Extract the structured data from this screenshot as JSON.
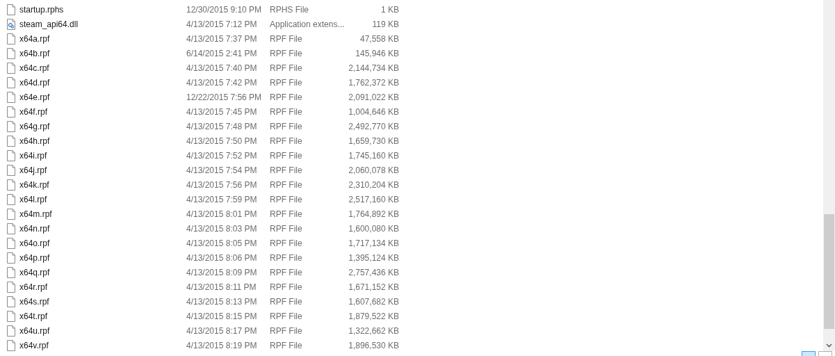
{
  "files": [
    {
      "name": "startup.rphs",
      "date": "12/30/2015 9:10 PM",
      "type": "RPHS File",
      "size": "1 KB",
      "kind": "document"
    },
    {
      "name": "steam_api64.dll",
      "date": "4/13/2015 7:12 PM",
      "type": "Application extens...",
      "size": "119 KB",
      "kind": "dll"
    },
    {
      "name": "x64a.rpf",
      "date": "4/13/2015 7:37 PM",
      "type": "RPF File",
      "size": "47,558 KB",
      "kind": "document"
    },
    {
      "name": "x64b.rpf",
      "date": "6/14/2015 2:41 PM",
      "type": "RPF File",
      "size": "145,946 KB",
      "kind": "document"
    },
    {
      "name": "x64c.rpf",
      "date": "4/13/2015 7:40 PM",
      "type": "RPF File",
      "size": "2,144,734 KB",
      "kind": "document"
    },
    {
      "name": "x64d.rpf",
      "date": "4/13/2015 7:42 PM",
      "type": "RPF File",
      "size": "1,762,372 KB",
      "kind": "document"
    },
    {
      "name": "x64e.rpf",
      "date": "12/22/2015 7:56 PM",
      "type": "RPF File",
      "size": "2,091,022 KB",
      "kind": "document"
    },
    {
      "name": "x64f.rpf",
      "date": "4/13/2015 7:45 PM",
      "type": "RPF File",
      "size": "1,004,646 KB",
      "kind": "document"
    },
    {
      "name": "x64g.rpf",
      "date": "4/13/2015 7:48 PM",
      "type": "RPF File",
      "size": "2,492,770 KB",
      "kind": "document"
    },
    {
      "name": "x64h.rpf",
      "date": "4/13/2015 7:50 PM",
      "type": "RPF File",
      "size": "1,659,730 KB",
      "kind": "document"
    },
    {
      "name": "x64i.rpf",
      "date": "4/13/2015 7:52 PM",
      "type": "RPF File",
      "size": "1,745,160 KB",
      "kind": "document"
    },
    {
      "name": "x64j.rpf",
      "date": "4/13/2015 7:54 PM",
      "type": "RPF File",
      "size": "2,060,078 KB",
      "kind": "document"
    },
    {
      "name": "x64k.rpf",
      "date": "4/13/2015 7:56 PM",
      "type": "RPF File",
      "size": "2,310,204 KB",
      "kind": "document"
    },
    {
      "name": "x64l.rpf",
      "date": "4/13/2015 7:59 PM",
      "type": "RPF File",
      "size": "2,517,160 KB",
      "kind": "document"
    },
    {
      "name": "x64m.rpf",
      "date": "4/13/2015 8:01 PM",
      "type": "RPF File",
      "size": "1,764,892 KB",
      "kind": "document"
    },
    {
      "name": "x64n.rpf",
      "date": "4/13/2015 8:03 PM",
      "type": "RPF File",
      "size": "1,600,080 KB",
      "kind": "document"
    },
    {
      "name": "x64o.rpf",
      "date": "4/13/2015 8:05 PM",
      "type": "RPF File",
      "size": "1,717,134 KB",
      "kind": "document"
    },
    {
      "name": "x64p.rpf",
      "date": "4/13/2015 8:06 PM",
      "type": "RPF File",
      "size": "1,395,124 KB",
      "kind": "document"
    },
    {
      "name": "x64q.rpf",
      "date": "4/13/2015 8:09 PM",
      "type": "RPF File",
      "size": "2,757,436 KB",
      "kind": "document"
    },
    {
      "name": "x64r.rpf",
      "date": "4/13/2015 8:11 PM",
      "type": "RPF File",
      "size": "1,671,152 KB",
      "kind": "document"
    },
    {
      "name": "x64s.rpf",
      "date": "4/13/2015 8:13 PM",
      "type": "RPF File",
      "size": "1,607,682 KB",
      "kind": "document"
    },
    {
      "name": "x64t.rpf",
      "date": "4/13/2015 8:15 PM",
      "type": "RPF File",
      "size": "1,879,522 KB",
      "kind": "document"
    },
    {
      "name": "x64u.rpf",
      "date": "4/13/2015 8:17 PM",
      "type": "RPF File",
      "size": "1,322,662 KB",
      "kind": "document"
    },
    {
      "name": "x64v.rpf",
      "date": "4/13/2015 8:19 PM",
      "type": "RPF File",
      "size": "1,896,530 KB",
      "kind": "document"
    }
  ],
  "view_buttons": [
    {
      "selected": true
    },
    {
      "selected": false
    }
  ]
}
